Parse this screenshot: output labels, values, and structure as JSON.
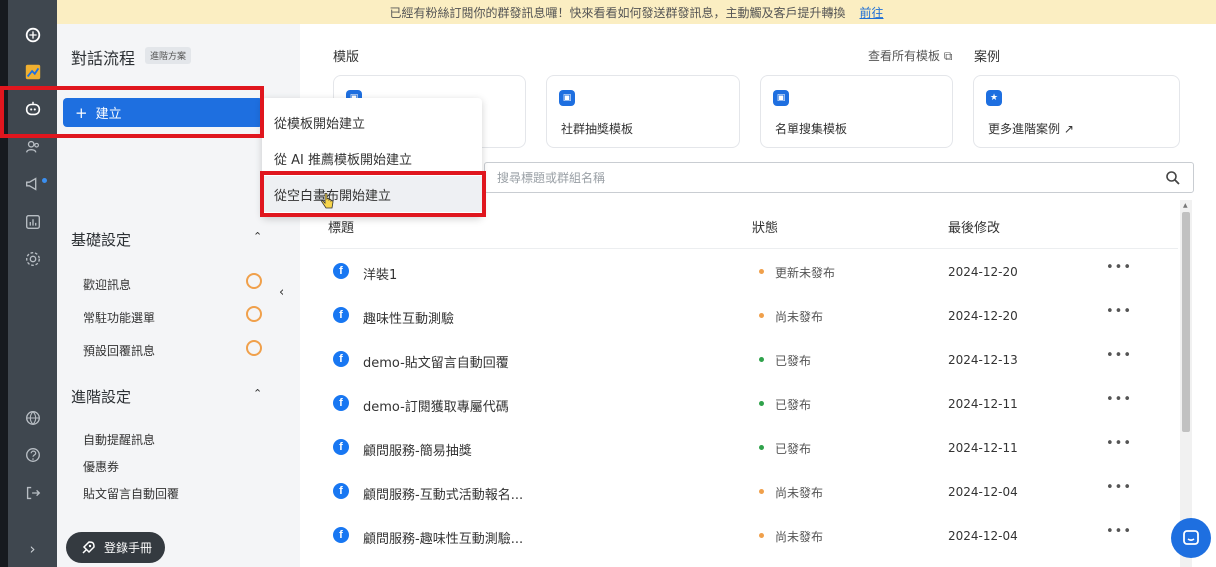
{
  "banner": {
    "text": "已經有粉絲訂閱你的群發訊息囉！快來看看如何發送群發訊息，主動觸及客戶提升轉換",
    "link": "前往"
  },
  "rail": {
    "icons": [
      "logo-icon",
      "image-icon",
      "bot-icon",
      "users-icon",
      "megaphone-icon",
      "chart-icon",
      "settings-icon",
      "globe-icon",
      "help-icon",
      "logout-icon"
    ],
    "expand": "›"
  },
  "panel": {
    "title": "對話流程",
    "plan_badge": "進階方案",
    "create_button": "建立",
    "basic_section": {
      "title": "基礎設定",
      "items": [
        "歡迎訊息",
        "常駐功能選單",
        "預設回覆訊息"
      ]
    },
    "advanced_section": {
      "title": "進階設定",
      "items": [
        "自動提醒訊息",
        "優惠券",
        "貼文留言自動回覆"
      ]
    },
    "manual_button": "登錄手冊"
  },
  "dropdown": {
    "items": [
      "從模板開始建立",
      "從 AI 推薦模板開始建立",
      "從空白畫布開始建立"
    ]
  },
  "templates": {
    "heading": "模版",
    "view_all": "查看所有模板",
    "cases_heading": "案例",
    "cards": [
      {
        "label": ""
      },
      {
        "label": "社群抽獎模板"
      },
      {
        "label": "名單搜集模板"
      },
      {
        "label": "更多進階案例"
      }
    ]
  },
  "search": {
    "placeholder": "搜尋標題或群組名稱"
  },
  "table": {
    "headers": {
      "title": "標題",
      "status": "狀態",
      "modified": "最後修改"
    },
    "rows": [
      {
        "title": "洋裝1",
        "status": "更新未發布",
        "date": "2024-12-20",
        "status_color": "#f0a04b"
      },
      {
        "title": "趣味性互動測驗",
        "status": "尚未發布",
        "date": "2024-12-20",
        "status_color": "#f0a04b"
      },
      {
        "title": "demo-貼文留言自動回覆",
        "status": "已發布",
        "date": "2024-12-13",
        "status_color": "#2fa24b"
      },
      {
        "title": "demo-訂閱獲取專屬代碼",
        "status": "已發布",
        "date": "2024-12-11",
        "status_color": "#2fa24b"
      },
      {
        "title": "顧問服務-簡易抽獎",
        "status": "已發布",
        "date": "2024-12-11",
        "status_color": "#2fa24b"
      },
      {
        "title": "顧問服務-互動式活動報名...",
        "status": "尚未發布",
        "date": "2024-12-04",
        "status_color": "#f0a04b"
      },
      {
        "title": "顧問服務-趣味性互動測驗...",
        "status": "尚未發布",
        "date": "2024-12-04",
        "status_color": "#f0a04b"
      }
    ]
  },
  "colors": {
    "accent": "#1e6fe0",
    "highlight": "#e0161e",
    "rail": "#3f474f",
    "banner": "#fbeec2"
  }
}
